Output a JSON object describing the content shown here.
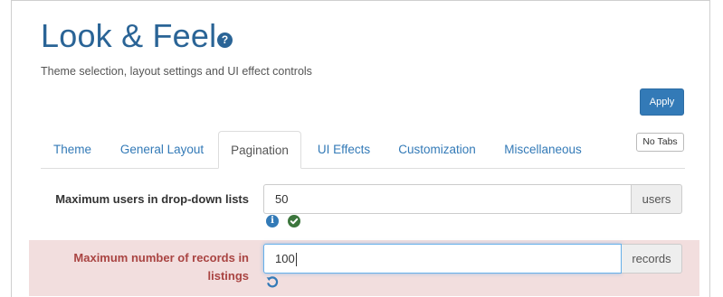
{
  "page": {
    "title": "Look & Feel",
    "help_icon": "question-circle-icon",
    "subtitle": "Theme selection, layout settings and UI effect controls"
  },
  "toolbar": {
    "apply_label": "Apply",
    "no_tabs_label": "No Tabs"
  },
  "tabs": [
    {
      "label": "Theme",
      "active": false
    },
    {
      "label": "General Layout",
      "active": false
    },
    {
      "label": "Pagination",
      "active": true
    },
    {
      "label": "UI Effects",
      "active": false
    },
    {
      "label": "Customization",
      "active": false
    },
    {
      "label": "Miscellaneous",
      "active": false
    }
  ],
  "settings": [
    {
      "label": "Maximum users in drop-down lists",
      "value": "50",
      "unit": "users",
      "status_icons": [
        "info-icon",
        "check-circle-icon"
      ],
      "state": "normal"
    },
    {
      "label": "Maximum number of records in listings",
      "value": "100",
      "unit": "records",
      "status_icons": [
        "undo-icon"
      ],
      "state": "modified"
    }
  ],
  "colors": {
    "title": "#2a6496",
    "link": "#337ab7",
    "primary_button": "#337ab7",
    "modified_row_bg": "#f2dede",
    "modified_row_text": "#a94442",
    "ok_icon": "#3c763d"
  }
}
